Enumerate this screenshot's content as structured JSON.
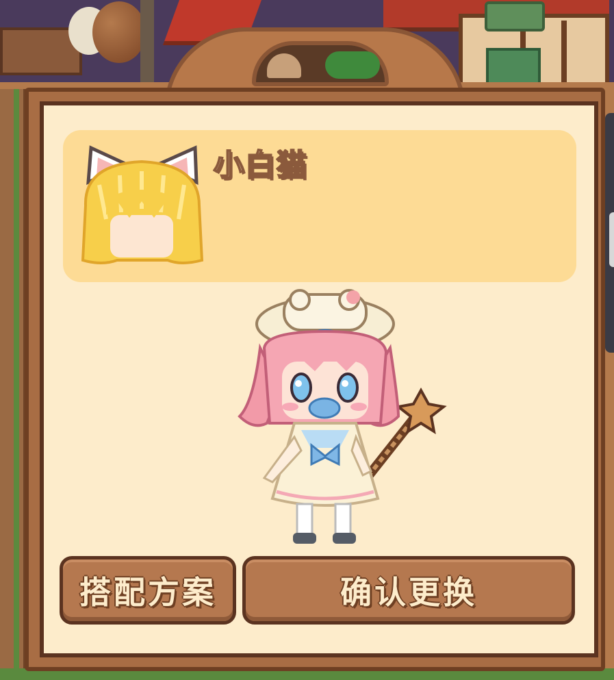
{
  "item": {
    "name": "小白猫",
    "icon": "cat-ear-blonde-hair-icon"
  },
  "character": {
    "icon": "chibi-character-avatar"
  },
  "buttons": {
    "outfit_label": "搭配方案",
    "confirm_label": "确认更换"
  },
  "colors": {
    "panel_bg": "#fdeccb",
    "card_bg": "#fddb95",
    "button_bg": "#b5784f",
    "border_dark": "#5b3320"
  }
}
